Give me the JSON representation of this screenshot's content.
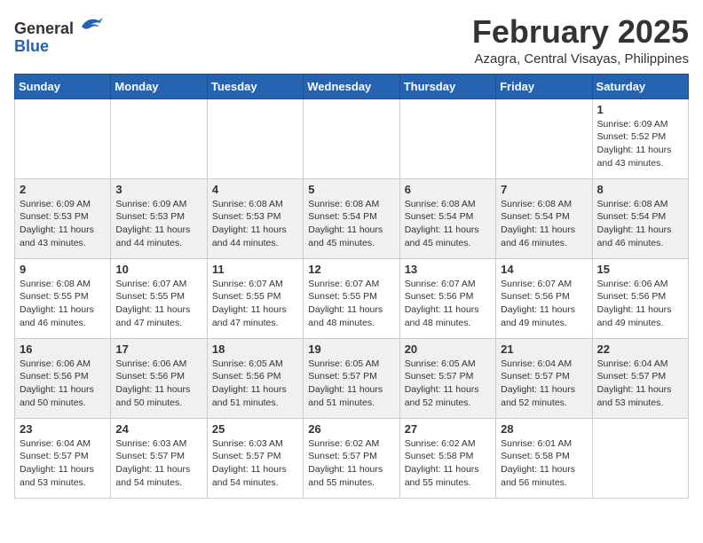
{
  "logo": {
    "general": "General",
    "blue": "Blue"
  },
  "title": {
    "month_year": "February 2025",
    "location": "Azagra, Central Visayas, Philippines"
  },
  "weekdays": [
    "Sunday",
    "Monday",
    "Tuesday",
    "Wednesday",
    "Thursday",
    "Friday",
    "Saturday"
  ],
  "weeks": [
    [
      {
        "day": "",
        "info": ""
      },
      {
        "day": "",
        "info": ""
      },
      {
        "day": "",
        "info": ""
      },
      {
        "day": "",
        "info": ""
      },
      {
        "day": "",
        "info": ""
      },
      {
        "day": "",
        "info": ""
      },
      {
        "day": "1",
        "info": "Sunrise: 6:09 AM\nSunset: 5:52 PM\nDaylight: 11 hours\nand 43 minutes."
      }
    ],
    [
      {
        "day": "2",
        "info": "Sunrise: 6:09 AM\nSunset: 5:53 PM\nDaylight: 11 hours\nand 43 minutes."
      },
      {
        "day": "3",
        "info": "Sunrise: 6:09 AM\nSunset: 5:53 PM\nDaylight: 11 hours\nand 44 minutes."
      },
      {
        "day": "4",
        "info": "Sunrise: 6:08 AM\nSunset: 5:53 PM\nDaylight: 11 hours\nand 44 minutes."
      },
      {
        "day": "5",
        "info": "Sunrise: 6:08 AM\nSunset: 5:54 PM\nDaylight: 11 hours\nand 45 minutes."
      },
      {
        "day": "6",
        "info": "Sunrise: 6:08 AM\nSunset: 5:54 PM\nDaylight: 11 hours\nand 45 minutes."
      },
      {
        "day": "7",
        "info": "Sunrise: 6:08 AM\nSunset: 5:54 PM\nDaylight: 11 hours\nand 46 minutes."
      },
      {
        "day": "8",
        "info": "Sunrise: 6:08 AM\nSunset: 5:54 PM\nDaylight: 11 hours\nand 46 minutes."
      }
    ],
    [
      {
        "day": "9",
        "info": "Sunrise: 6:08 AM\nSunset: 5:55 PM\nDaylight: 11 hours\nand 46 minutes."
      },
      {
        "day": "10",
        "info": "Sunrise: 6:07 AM\nSunset: 5:55 PM\nDaylight: 11 hours\nand 47 minutes."
      },
      {
        "day": "11",
        "info": "Sunrise: 6:07 AM\nSunset: 5:55 PM\nDaylight: 11 hours\nand 47 minutes."
      },
      {
        "day": "12",
        "info": "Sunrise: 6:07 AM\nSunset: 5:55 PM\nDaylight: 11 hours\nand 48 minutes."
      },
      {
        "day": "13",
        "info": "Sunrise: 6:07 AM\nSunset: 5:56 PM\nDaylight: 11 hours\nand 48 minutes."
      },
      {
        "day": "14",
        "info": "Sunrise: 6:07 AM\nSunset: 5:56 PM\nDaylight: 11 hours\nand 49 minutes."
      },
      {
        "day": "15",
        "info": "Sunrise: 6:06 AM\nSunset: 5:56 PM\nDaylight: 11 hours\nand 49 minutes."
      }
    ],
    [
      {
        "day": "16",
        "info": "Sunrise: 6:06 AM\nSunset: 5:56 PM\nDaylight: 11 hours\nand 50 minutes."
      },
      {
        "day": "17",
        "info": "Sunrise: 6:06 AM\nSunset: 5:56 PM\nDaylight: 11 hours\nand 50 minutes."
      },
      {
        "day": "18",
        "info": "Sunrise: 6:05 AM\nSunset: 5:56 PM\nDaylight: 11 hours\nand 51 minutes."
      },
      {
        "day": "19",
        "info": "Sunrise: 6:05 AM\nSunset: 5:57 PM\nDaylight: 11 hours\nand 51 minutes."
      },
      {
        "day": "20",
        "info": "Sunrise: 6:05 AM\nSunset: 5:57 PM\nDaylight: 11 hours\nand 52 minutes."
      },
      {
        "day": "21",
        "info": "Sunrise: 6:04 AM\nSunset: 5:57 PM\nDaylight: 11 hours\nand 52 minutes."
      },
      {
        "day": "22",
        "info": "Sunrise: 6:04 AM\nSunset: 5:57 PM\nDaylight: 11 hours\nand 53 minutes."
      }
    ],
    [
      {
        "day": "23",
        "info": "Sunrise: 6:04 AM\nSunset: 5:57 PM\nDaylight: 11 hours\nand 53 minutes."
      },
      {
        "day": "24",
        "info": "Sunrise: 6:03 AM\nSunset: 5:57 PM\nDaylight: 11 hours\nand 54 minutes."
      },
      {
        "day": "25",
        "info": "Sunrise: 6:03 AM\nSunset: 5:57 PM\nDaylight: 11 hours\nand 54 minutes."
      },
      {
        "day": "26",
        "info": "Sunrise: 6:02 AM\nSunset: 5:57 PM\nDaylight: 11 hours\nand 55 minutes."
      },
      {
        "day": "27",
        "info": "Sunrise: 6:02 AM\nSunset: 5:58 PM\nDaylight: 11 hours\nand 55 minutes."
      },
      {
        "day": "28",
        "info": "Sunrise: 6:01 AM\nSunset: 5:58 PM\nDaylight: 11 hours\nand 56 minutes."
      },
      {
        "day": "",
        "info": ""
      }
    ]
  ]
}
